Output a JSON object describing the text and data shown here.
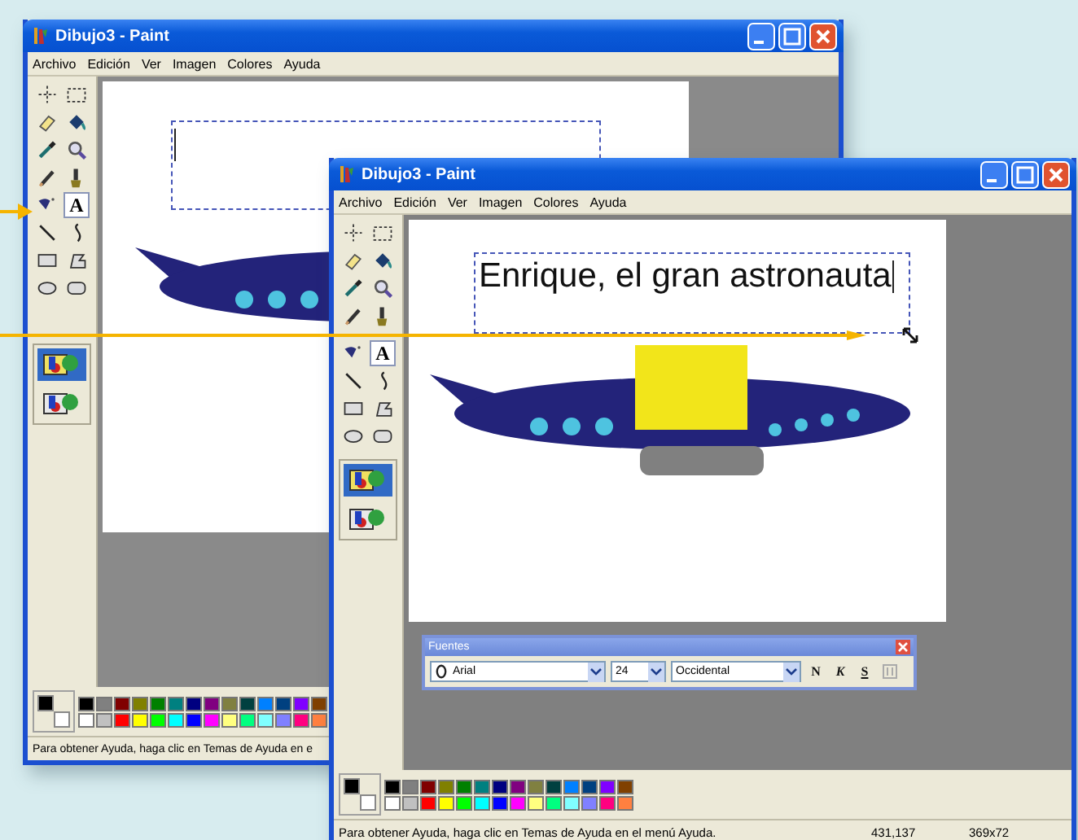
{
  "windows": [
    {
      "title": "Dibujo3 - Paint",
      "menu": [
        "Archivo",
        "Edición",
        "Ver",
        "Imagen",
        "Colores",
        "Ayuda"
      ],
      "tools": [
        {
          "kind": "free-select",
          "selected": false
        },
        {
          "kind": "select",
          "selected": false
        },
        {
          "kind": "eraser",
          "selected": false
        },
        {
          "kind": "fill",
          "selected": false
        },
        {
          "kind": "picker",
          "selected": false
        },
        {
          "kind": "magnifier",
          "selected": false
        },
        {
          "kind": "pencil",
          "selected": false
        },
        {
          "kind": "brush",
          "selected": false
        },
        {
          "kind": "airbrush",
          "selected": false
        },
        {
          "kind": "text",
          "label": "A",
          "selected": true
        },
        {
          "kind": "line",
          "selected": false
        },
        {
          "kind": "curve",
          "selected": false
        },
        {
          "kind": "rectangle",
          "selected": false
        },
        {
          "kind": "polygon",
          "selected": false
        },
        {
          "kind": "ellipse",
          "selected": false
        },
        {
          "kind": "rounded-rect",
          "selected": false
        }
      ],
      "tool_options": [
        {
          "selected": true
        },
        {
          "selected": false
        }
      ],
      "text_box": {
        "caret": true
      },
      "palette": {
        "foreground": {
          "color": "#000000"
        },
        "background": {
          "color": "#ffffff"
        },
        "colors": [
          {
            "color": "#000000"
          },
          {
            "color": "#808080"
          },
          {
            "color": "#800000"
          },
          {
            "color": "#808000"
          },
          {
            "color": "#008000"
          },
          {
            "color": "#008080"
          },
          {
            "color": "#000080"
          },
          {
            "color": "#800080"
          },
          {
            "color": "#808040"
          },
          {
            "color": "#004040"
          },
          {
            "color": "#0080ff"
          },
          {
            "color": "#004080"
          },
          {
            "color": "#8000ff"
          },
          {
            "color": "#804000"
          },
          {
            "color": "#ffffff"
          },
          {
            "color": "#c0c0c0"
          },
          {
            "color": "#ff0000"
          },
          {
            "color": "#ffff00"
          },
          {
            "color": "#00ff00"
          },
          {
            "color": "#00ffff"
          },
          {
            "color": "#0000ff"
          },
          {
            "color": "#ff00ff"
          },
          {
            "color": "#ffff80"
          },
          {
            "color": "#00ff80"
          },
          {
            "color": "#80ffff"
          },
          {
            "color": "#8080ff"
          },
          {
            "color": "#ff0080"
          },
          {
            "color": "#ff8040"
          }
        ]
      },
      "status_bar": [
        "Para obtener Ayuda, haga clic en Temas de Ayuda en e"
      ]
    },
    {
      "title": "Dibujo3 - Paint",
      "menu": [
        "Archivo",
        "Edición",
        "Ver",
        "Imagen",
        "Colores",
        "Ayuda"
      ],
      "tools": [
        {
          "kind": "free-select",
          "selected": false
        },
        {
          "kind": "select",
          "selected": false
        },
        {
          "kind": "eraser",
          "selected": false
        },
        {
          "kind": "fill",
          "selected": false
        },
        {
          "kind": "picker",
          "selected": false
        },
        {
          "kind": "magnifier",
          "selected": false
        },
        {
          "kind": "pencil",
          "selected": false
        },
        {
          "kind": "brush",
          "selected": false
        },
        {
          "kind": "airbrush",
          "selected": false
        },
        {
          "kind": "text",
          "label": "A",
          "selected": true
        },
        {
          "kind": "line",
          "selected": false
        },
        {
          "kind": "curve",
          "selected": false
        },
        {
          "kind": "rectangle",
          "selected": false
        },
        {
          "kind": "polygon",
          "selected": false
        },
        {
          "kind": "ellipse",
          "selected": false
        },
        {
          "kind": "rounded-rect",
          "selected": false
        }
      ],
      "tool_options": [
        {
          "selected": true
        },
        {
          "selected": false
        }
      ],
      "text_box": {
        "text": "Enrique, el gran astronauta",
        "caret": true
      },
      "fonts_toolbar": {
        "title": "Fuentes",
        "font": "Arial",
        "size": "24",
        "script": "Occidental",
        "buttons": [
          {
            "kind": "bold",
            "label": "N",
            "disabled": false
          },
          {
            "kind": "italic",
            "label": "K",
            "disabled": false
          },
          {
            "kind": "underline",
            "label": "S",
            "disabled": false
          },
          {
            "kind": "vertical",
            "disabled": true
          }
        ]
      },
      "palette": {
        "foreground": {
          "color": "#000000"
        },
        "background": {
          "color": "#ffffff"
        },
        "colors": [
          {
            "color": "#000000"
          },
          {
            "color": "#808080"
          },
          {
            "color": "#800000"
          },
          {
            "color": "#808000"
          },
          {
            "color": "#008000"
          },
          {
            "color": "#008080"
          },
          {
            "color": "#000080"
          },
          {
            "color": "#800080"
          },
          {
            "color": "#808040"
          },
          {
            "color": "#004040"
          },
          {
            "color": "#0080ff"
          },
          {
            "color": "#004080"
          },
          {
            "color": "#8000ff"
          },
          {
            "color": "#804000"
          },
          {
            "color": "#ffffff"
          },
          {
            "color": "#c0c0c0"
          },
          {
            "color": "#ff0000"
          },
          {
            "color": "#ffff00"
          },
          {
            "color": "#00ff00"
          },
          {
            "color": "#00ffff"
          },
          {
            "color": "#0000ff"
          },
          {
            "color": "#ff00ff"
          },
          {
            "color": "#ffff80"
          },
          {
            "color": "#00ff80"
          },
          {
            "color": "#80ffff"
          },
          {
            "color": "#8080ff"
          },
          {
            "color": "#ff0080"
          },
          {
            "color": "#ff8040"
          }
        ]
      },
      "status_bar": [
        "Para obtener Ayuda, haga clic en Temas de Ayuda en el menú Ayuda.",
        "431,137",
        "369x72"
      ]
    }
  ]
}
